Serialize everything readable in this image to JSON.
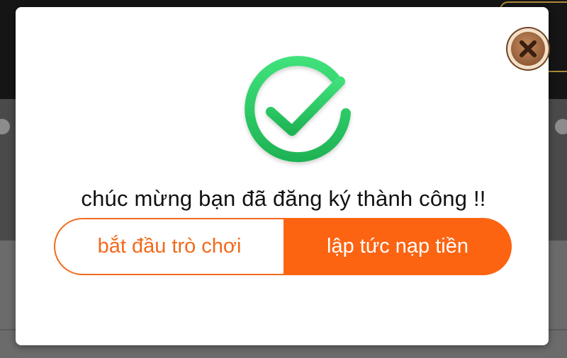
{
  "modal": {
    "message": "chúc mừng bạn đã đăng ký thành công !!",
    "buttons": {
      "start_label": "bắt đầu trò chơi",
      "deposit_label": "lập tức nạp tiền"
    }
  },
  "icons": {
    "success": "check-circle-icon",
    "close": "close-icon"
  },
  "colors": {
    "accent_orange": "#fc6412",
    "success_green": "#2fcf6a",
    "close_brown": "#a8714a"
  }
}
